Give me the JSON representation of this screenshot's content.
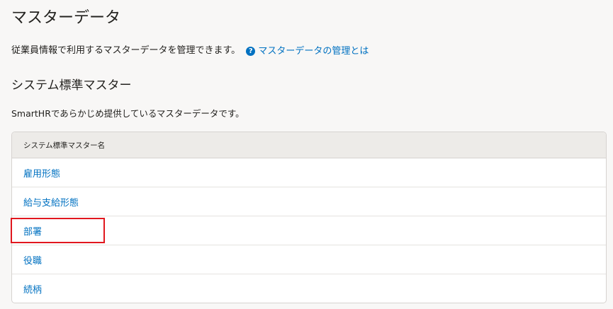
{
  "page": {
    "title": "マスターデータ",
    "description": "従業員情報で利用するマスターデータを管理できます。",
    "help_link_label": "マスターデータの管理とは"
  },
  "section": {
    "title": "システム標準マスター",
    "description": "SmartHRであらかじめ提供しているマスターデータです。",
    "table_header": "システム標準マスター名",
    "rows": [
      {
        "label": "雇用形態"
      },
      {
        "label": "給与支給形態"
      },
      {
        "label": "部署"
      },
      {
        "label": "役職"
      },
      {
        "label": "続柄"
      }
    ]
  },
  "colors": {
    "link": "#0071c1",
    "highlight": "#e1171e",
    "header_bg": "#edebe8",
    "page_bg": "#f8f7f6"
  }
}
